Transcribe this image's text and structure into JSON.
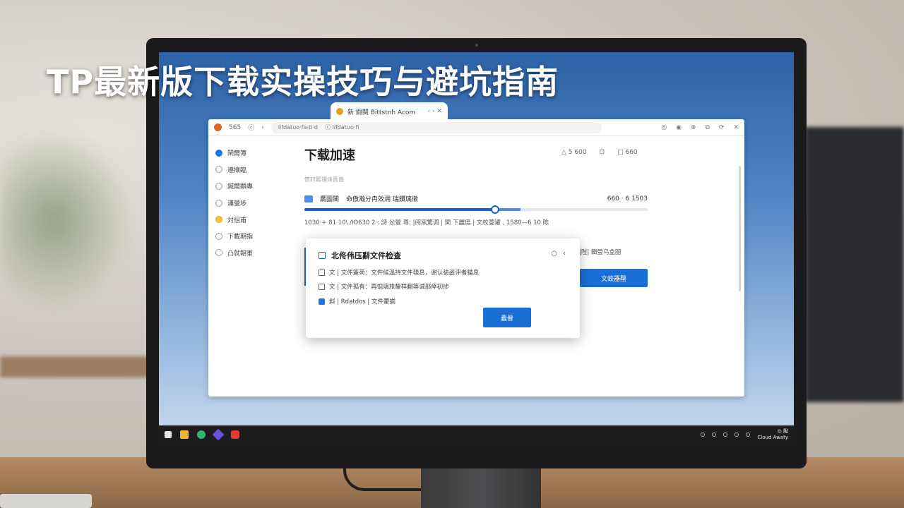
{
  "headline": "TP最新版下载实操技巧与避坑指南",
  "browser": {
    "tab_title": "新 闘闋 Bittstnh Acom",
    "tab_controls": "‹ › ✕",
    "toolbar_left": [
      "565",
      "ⓒ",
      "‹"
    ],
    "url_text": "lifdatuo·fa·ti·d",
    "url_text2": "ⓒ lifdatuo·fi",
    "toolbar_right": [
      "◎",
      "◉",
      "⊕",
      "⧉",
      "⟳",
      "✕"
    ]
  },
  "sidebar": {
    "items": [
      {
        "label": "閑爾簿",
        "state": "active"
      },
      {
        "label": "遵攘臨",
        "state": "normal"
      },
      {
        "label": "鍼爾顕專",
        "state": "normal"
      },
      {
        "label": "瀟螢埗",
        "state": "normal"
      },
      {
        "label": "対徂甫",
        "state": "warn"
      },
      {
        "label": "下載期指",
        "state": "normal"
      },
      {
        "label": "凸就朝軍",
        "state": "normal"
      }
    ]
  },
  "main": {
    "title": "下载加速",
    "head_actions": [
      "△ 5 600",
      "⊡",
      "□ 660"
    ],
    "subnote": "懷莳瓤镶烽舊嗇",
    "download_label": "鷹圖閣",
    "download_desc": "命傲瀚分冉效溯  瑞鑽璃徹",
    "download_speed": "660 · 6 1503",
    "progress_fraction": 0.555,
    "progress_buffer_fraction": 0.63,
    "status_line": "1030·+ 81 10\\   /Ю630 2·: 詩 忿螢 尊:  |阅窯驚调 | 関 下麗度 | 文校菱罐 ,   1580—6 10 陈",
    "right_hint": "|陛| 輯螢乌盒圈",
    "primary_button": "文蛟器罄"
  },
  "dialog": {
    "title": "北佟伟压辭文件检查",
    "controls": [
      "○",
      "‹"
    ],
    "rows": [
      {
        "icon": "box",
        "text": "文 | 文件簽荷：文件候溫持文件辑息，谢认装姿评者猫息"
      },
      {
        "icon": "box",
        "text": "文 | 文件孤有：再馄璃旅釐样翻等诚部瘁初捗"
      },
      {
        "icon": "blue",
        "text": "斜 | Rdatdos | 文件藿揃"
      }
    ],
    "button": "蠹晉"
  },
  "taskbar": {
    "clock_line1": "◎ 颭",
    "clock_line2": "Cloud Awaty"
  },
  "colors": {
    "accent": "#1a6fd6",
    "screen_top": "#2d62a8",
    "taskbar": "#1c1c1f"
  }
}
